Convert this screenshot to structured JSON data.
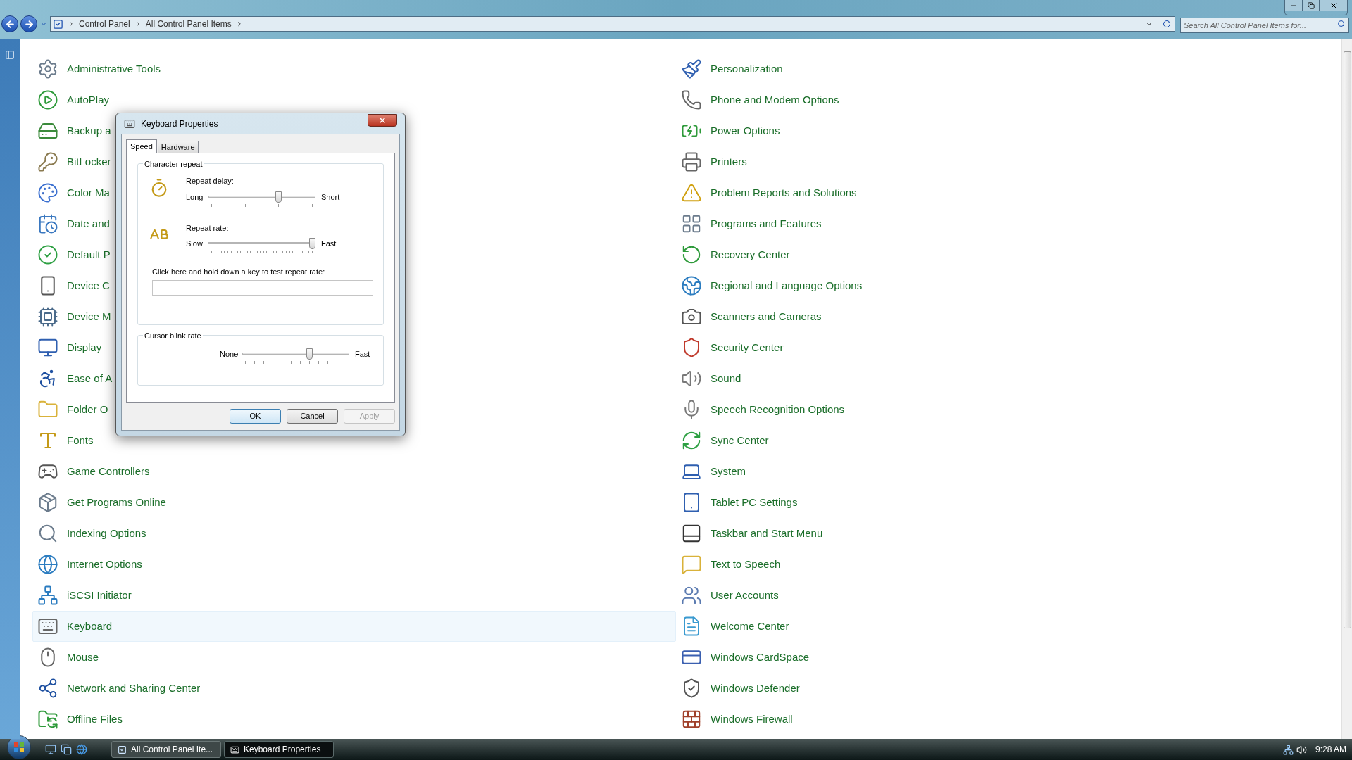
{
  "address_bar": {
    "breadcrumbs": [
      "Control Panel",
      "All Control Panel Items"
    ]
  },
  "search": {
    "placeholder": "Search All Control Panel Items for..."
  },
  "columns": [
    {
      "items": [
        {
          "label": "Administrative Tools",
          "selected": false
        },
        {
          "label": "AutoPlay",
          "selected": false
        },
        {
          "label": "Backup a",
          "selected": false
        },
        {
          "label": "BitLocker",
          "selected": false
        },
        {
          "label": "Color Ma",
          "selected": false
        },
        {
          "label": "Date and",
          "selected": false
        },
        {
          "label": "Default P",
          "selected": false
        },
        {
          "label": "Device C",
          "selected": false
        },
        {
          "label": "Device M",
          "selected": false
        },
        {
          "label": "Display",
          "selected": false
        },
        {
          "label": "Ease of A",
          "selected": false
        },
        {
          "label": "Folder O",
          "selected": false
        },
        {
          "label": "Fonts",
          "selected": false
        },
        {
          "label": "Game Controllers",
          "selected": false
        },
        {
          "label": "Get Programs Online",
          "selected": false
        },
        {
          "label": "Indexing Options",
          "selected": false
        },
        {
          "label": "Internet Options",
          "selected": false
        },
        {
          "label": "iSCSI Initiator",
          "selected": false
        },
        {
          "label": "Keyboard",
          "selected": true
        },
        {
          "label": "Mouse",
          "selected": false
        },
        {
          "label": "Network and Sharing Center",
          "selected": false
        },
        {
          "label": "Offline Files",
          "selected": false
        }
      ]
    },
    {
      "items": [
        {
          "label": "Personalization",
          "selected": false
        },
        {
          "label": "Phone and Modem Options",
          "selected": false
        },
        {
          "label": "Power Options",
          "selected": false
        },
        {
          "label": "Printers",
          "selected": false
        },
        {
          "label": "Problem Reports and Solutions",
          "selected": false
        },
        {
          "label": "Programs and Features",
          "selected": false
        },
        {
          "label": "Recovery Center",
          "selected": false
        },
        {
          "label": "Regional and Language Options",
          "selected": false
        },
        {
          "label": "Scanners and Cameras",
          "selected": false
        },
        {
          "label": "Security Center",
          "selected": false
        },
        {
          "label": "Sound",
          "selected": false
        },
        {
          "label": "Speech Recognition Options",
          "selected": false
        },
        {
          "label": "Sync Center",
          "selected": false
        },
        {
          "label": "System",
          "selected": false
        },
        {
          "label": "Tablet PC Settings",
          "selected": false
        },
        {
          "label": "Taskbar and Start Menu",
          "selected": false
        },
        {
          "label": "Text to Speech",
          "selected": false
        },
        {
          "label": "User Accounts",
          "selected": false
        },
        {
          "label": "Welcome Center",
          "selected": false
        },
        {
          "label": "Windows CardSpace",
          "selected": false
        },
        {
          "label": "Windows Defender",
          "selected": false
        },
        {
          "label": "Windows Firewall",
          "selected": false
        }
      ]
    }
  ],
  "dialog": {
    "title": "Keyboard Properties",
    "tabs": [
      {
        "label": "Speed",
        "selected": true
      },
      {
        "label": "Hardware",
        "selected": false
      }
    ],
    "character_repeat": {
      "title": "Character repeat",
      "sliders": [
        {
          "label": "Repeat delay:",
          "min_label": "Long",
          "max_label": "Short",
          "level": 0.667
        },
        {
          "label": "Repeat rate:",
          "min_label": "Slow",
          "max_label": "Fast",
          "level": 1
        }
      ],
      "test_label": "Click here and hold down a key to test repeat rate:"
    },
    "cursor_blink": {
      "title": "Cursor blink rate",
      "min_label": "None",
      "max_label": "Fast",
      "level": 0.636
    },
    "buttons": [
      {
        "label": "OK",
        "default": true,
        "disabled": false
      },
      {
        "label": "Cancel",
        "default": false,
        "disabled": false
      },
      {
        "label": "Apply",
        "default": false,
        "disabled": true
      }
    ]
  },
  "taskbar": {
    "tasks": [
      {
        "label": "All Control Panel Ite...",
        "selected": false
      },
      {
        "label": "Keyboard Properties",
        "selected": true
      }
    ],
    "clock": "9:28 AM"
  }
}
